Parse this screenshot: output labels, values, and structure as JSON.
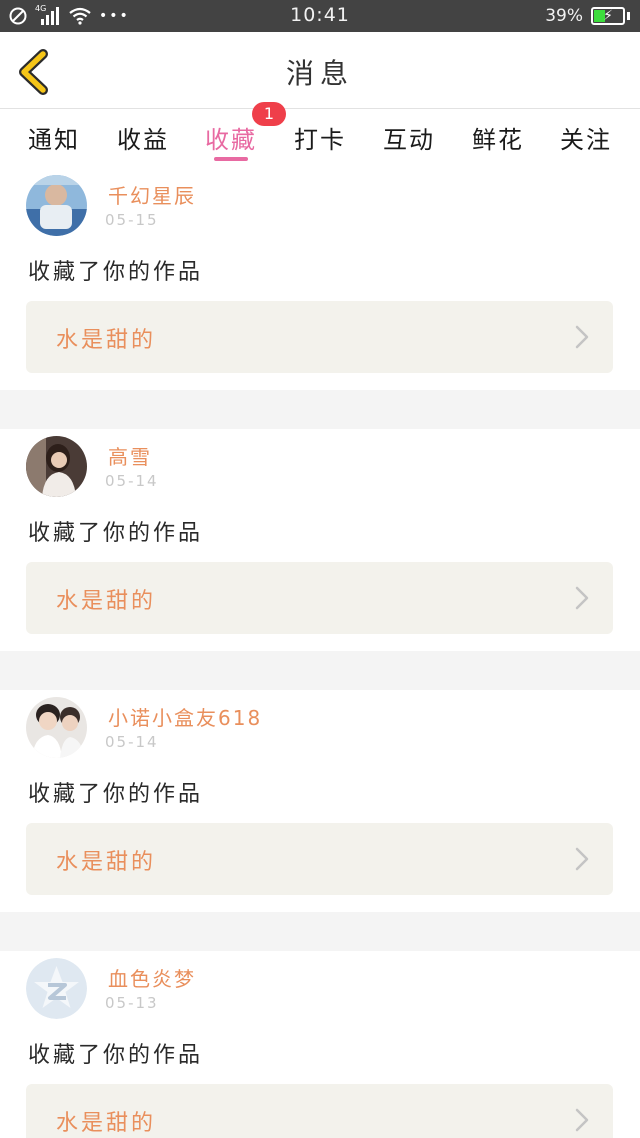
{
  "status_bar": {
    "time": "10:41",
    "battery_percent": "39%",
    "battery_level": 0.39,
    "signal_label": "4G",
    "dots": "•••"
  },
  "header": {
    "title": "消息"
  },
  "tabs": [
    {
      "label": "通知"
    },
    {
      "label": "收益"
    },
    {
      "label": "收藏",
      "active": true,
      "badge": "1"
    },
    {
      "label": "打卡"
    },
    {
      "label": "互动"
    },
    {
      "label": "鲜花"
    },
    {
      "label": "关注"
    }
  ],
  "items": [
    {
      "username": "千幻星辰",
      "date": "05-15",
      "message": "收藏了你的作品",
      "work_title": "水是甜的"
    },
    {
      "username": "高雪",
      "date": "05-14",
      "message": "收藏了你的作品",
      "work_title": "水是甜的"
    },
    {
      "username": "小诺小盒友618",
      "date": "05-14",
      "message": "收藏了你的作品",
      "work_title": "水是甜的"
    },
    {
      "username": "血色炎梦",
      "date": "05-13",
      "message": "收藏了你的作品",
      "work_title": "水是甜的"
    }
  ],
  "colors": {
    "accent_pink": "#e86aa2",
    "username_orange": "#e98f5c",
    "badge_red": "#ef3f4a",
    "back_arrow_yellow": "#f5c518"
  }
}
